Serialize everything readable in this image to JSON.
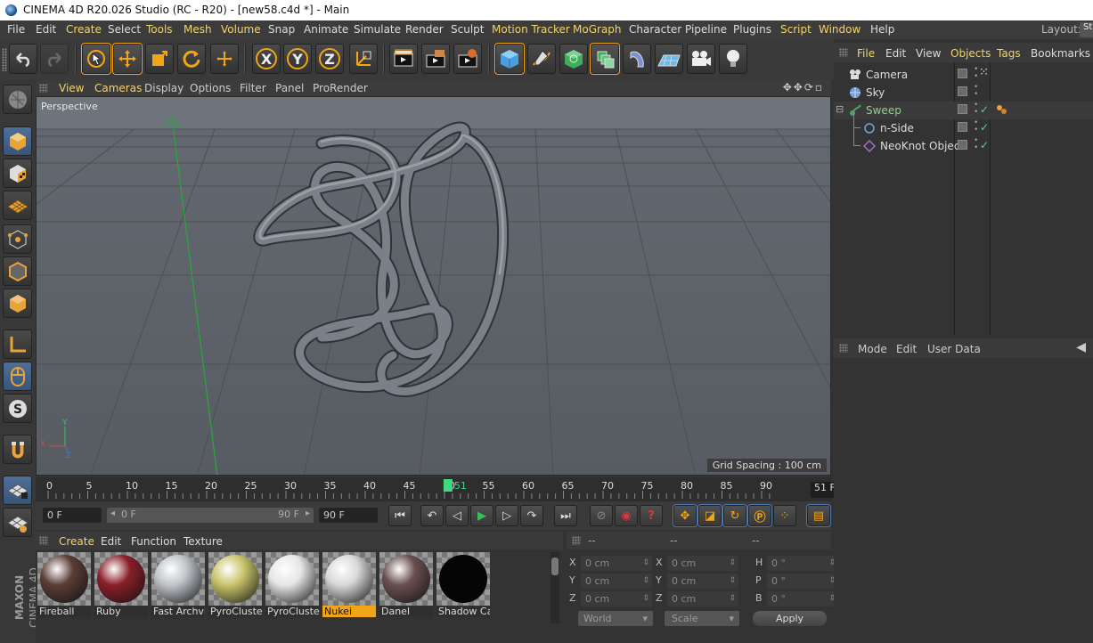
{
  "window": {
    "title": "CINEMA 4D R20.026 Studio (RC - R20) - [new58.c4d *] - Main"
  },
  "menubar": {
    "items": [
      {
        "label": "File",
        "highlight": false
      },
      {
        "label": "Edit",
        "highlight": false
      },
      {
        "label": "Create",
        "highlight": true
      },
      {
        "label": "Select",
        "highlight": false
      },
      {
        "label": "Tools",
        "highlight": true
      },
      {
        "label": "Mesh",
        "highlight": true
      },
      {
        "label": "Volume",
        "highlight": true
      },
      {
        "label": "Snap",
        "highlight": false
      },
      {
        "label": "Animate",
        "highlight": false
      },
      {
        "label": "Simulate",
        "highlight": false
      },
      {
        "label": "Render",
        "highlight": false
      },
      {
        "label": "Sculpt",
        "highlight": false
      },
      {
        "label": "Motion Tracker",
        "highlight": true
      },
      {
        "label": "MoGraph",
        "highlight": true
      },
      {
        "label": "Character",
        "highlight": false
      },
      {
        "label": "Pipeline",
        "highlight": false
      },
      {
        "label": "Plugins",
        "highlight": false
      },
      {
        "label": "Script",
        "highlight": true
      },
      {
        "label": "Window",
        "highlight": true
      },
      {
        "label": "Help",
        "highlight": false
      }
    ],
    "layout_label": "Layout:",
    "layout_value": "St"
  },
  "toolbar": {
    "axis_x": "X",
    "axis_y": "Y",
    "axis_z": "Z"
  },
  "viewport": {
    "menu": [
      {
        "label": "View",
        "highlight": true
      },
      {
        "label": "Cameras",
        "highlight": true
      },
      {
        "label": "Display",
        "highlight": false
      },
      {
        "label": "Options",
        "highlight": false
      },
      {
        "label": "Filter",
        "highlight": false
      },
      {
        "label": "Panel",
        "highlight": false
      },
      {
        "label": "ProRender",
        "highlight": false
      }
    ],
    "camera_label": "Perspective",
    "grid_spacing": "Grid Spacing : 100 cm",
    "axis_labels": {
      "y": "Y",
      "x": "X",
      "z": "Z"
    }
  },
  "timeline": {
    "ticks": [
      "0",
      "5",
      "10",
      "15",
      "20",
      "25",
      "30",
      "35",
      "40",
      "45",
      "50",
      "55",
      "60",
      "65",
      "70",
      "75",
      "80",
      "85",
      "90"
    ],
    "current_frame_marker": "51",
    "end_frame_display": "51 F"
  },
  "transport": {
    "start_field": "0 F",
    "range_start": "0 F",
    "range_end": "90 F",
    "end_field": "90 F"
  },
  "materials": {
    "menu": [
      {
        "label": "Create",
        "highlight": true
      },
      {
        "label": "Edit",
        "highlight": false
      },
      {
        "label": "Function",
        "highlight": false
      },
      {
        "label": "Texture",
        "highlight": false
      }
    ],
    "items": [
      {
        "name": "Fireball",
        "color": "#5a3d36",
        "selected": false
      },
      {
        "name": "Ruby",
        "color": "#8a1f28",
        "selected": false
      },
      {
        "name": "Fast Archvi",
        "color": "#bfc4c9",
        "selected": false
      },
      {
        "name": "PyroCluster",
        "color": "#c9c46a",
        "selected": false
      },
      {
        "name": "PyroCluster",
        "color": "#e6e6e6",
        "selected": false
      },
      {
        "name": "Nukei",
        "color": "#d8d8d8",
        "selected": true
      },
      {
        "name": "Danel",
        "color": "#6a4f4f",
        "selected": false
      },
      {
        "name": "Shadow Ca",
        "color": "#050505",
        "selected": false
      }
    ],
    "brand_line1": "MAXON",
    "brand_line2": "CINEMA 4D"
  },
  "coords": {
    "headers": [
      "--",
      "--",
      "--"
    ],
    "rows": [
      {
        "a": "X",
        "av": "0 cm",
        "b": "X",
        "bv": "0 cm",
        "c": "H",
        "cv": "0 °"
      },
      {
        "a": "Y",
        "av": "0 cm",
        "b": "Y",
        "bv": "0 cm",
        "c": "P",
        "cv": "0 °"
      },
      {
        "a": "Z",
        "av": "0 cm",
        "b": "Z",
        "bv": "0 cm",
        "c": "B",
        "cv": "0 °"
      }
    ],
    "mode1": "World",
    "mode2": "Scale",
    "apply": "Apply"
  },
  "object_manager": {
    "menu": [
      {
        "label": "File",
        "highlight": true
      },
      {
        "label": "Edit",
        "highlight": false
      },
      {
        "label": "View",
        "highlight": false
      },
      {
        "label": "Objects",
        "highlight": true
      },
      {
        "label": "Tags",
        "highlight": true
      },
      {
        "label": "Bookmarks",
        "highlight": false
      }
    ],
    "objects": [
      {
        "name": "Camera",
        "icon": "camera-icon",
        "indent": 0,
        "color": "#ddd"
      },
      {
        "name": "Sky",
        "icon": "sky-icon",
        "indent": 0,
        "color": "#ddd"
      },
      {
        "name": "Sweep",
        "icon": "sweep-icon",
        "indent": 0,
        "color": "#8fd08f"
      },
      {
        "name": "n-Side",
        "icon": "nside-icon",
        "indent": 1,
        "color": "#ddd"
      },
      {
        "name": "NeoKnot Object",
        "icon": "neoknot-icon",
        "indent": 1,
        "color": "#ddd"
      }
    ]
  },
  "attributes": {
    "menu": [
      "Mode",
      "Edit",
      "User Data"
    ]
  }
}
